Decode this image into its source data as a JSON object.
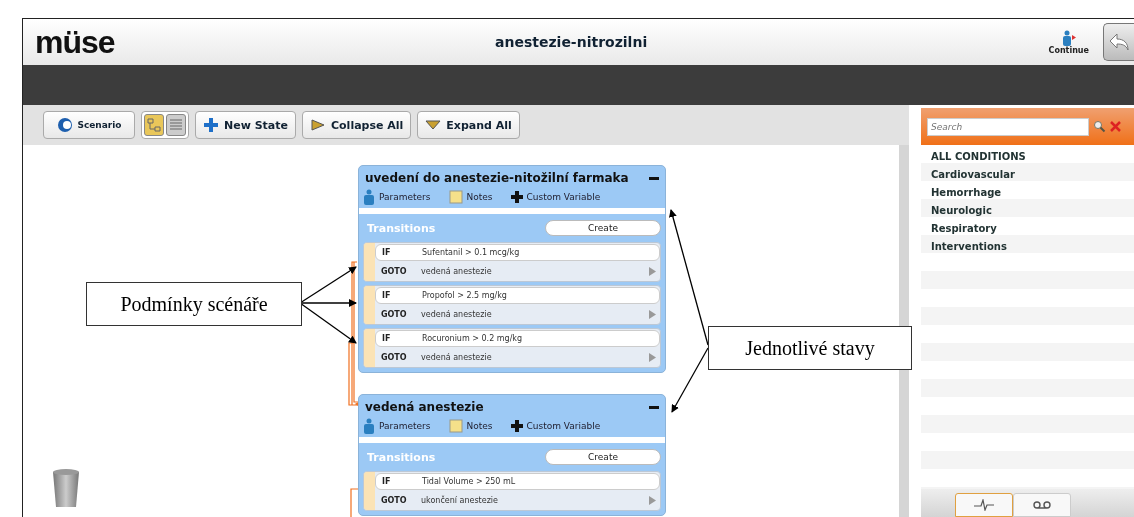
{
  "app": {
    "logo": "müse",
    "title": "anestezie-nitrozilni",
    "continue_label": "Continue"
  },
  "toolbar": {
    "scenario": "Scenario",
    "view_modes": [
      {
        "selected": true
      },
      {
        "selected": false
      }
    ],
    "buttons": [
      {
        "kind": "new",
        "label": "New State"
      },
      {
        "kind": "collapse",
        "label": "Collapse All"
      },
      {
        "kind": "expand",
        "label": "Expand All"
      }
    ]
  },
  "states": [
    {
      "title": "uvedení do anestezie-nitožilní farmaka",
      "tools": [
        "Parameters",
        "Notes",
        "Custom Variable"
      ],
      "transitions_label": "Transitions",
      "create": "Create",
      "transitions": [
        {
          "if_label": "IF",
          "condition": "Sufentanil > 0.1 mcg/kg",
          "goto_label": "GOTO",
          "target": "vedená anestezie"
        },
        {
          "if_label": "IF",
          "condition": "Propofol > 2.5 mg/kg",
          "goto_label": "GOTO",
          "target": "vedená anestezie"
        },
        {
          "if_label": "IF",
          "condition": "Rocuronium > 0.2 mg/kg",
          "goto_label": "GOTO",
          "target": "vedená anestezie"
        }
      ]
    },
    {
      "title": "vedená anestezie",
      "tools": [
        "Parameters",
        "Notes",
        "Custom Variable"
      ],
      "transitions_label": "Transitions",
      "create": "Create",
      "transitions": [
        {
          "if_label": "IF",
          "condition": "Tidal Volume > 250 mL",
          "goto_label": "GOTO",
          "target": "ukončení anestezie"
        }
      ]
    }
  ],
  "conditions": {
    "search": {
      "placeholder": "Search"
    },
    "items": [
      "ALL CONDITIONS",
      "Cardiovascular",
      "Hemorrhage",
      "Neurologic",
      "Respiratory",
      "Interventions"
    ],
    "tabs": [
      {
        "kind": "vitals",
        "selected": true
      },
      {
        "kind": "tape",
        "selected": false
      }
    ]
  },
  "annotations": [
    {
      "text": "Podmínky scénáře"
    },
    {
      "text": "Jednotlivé stavy"
    }
  ]
}
